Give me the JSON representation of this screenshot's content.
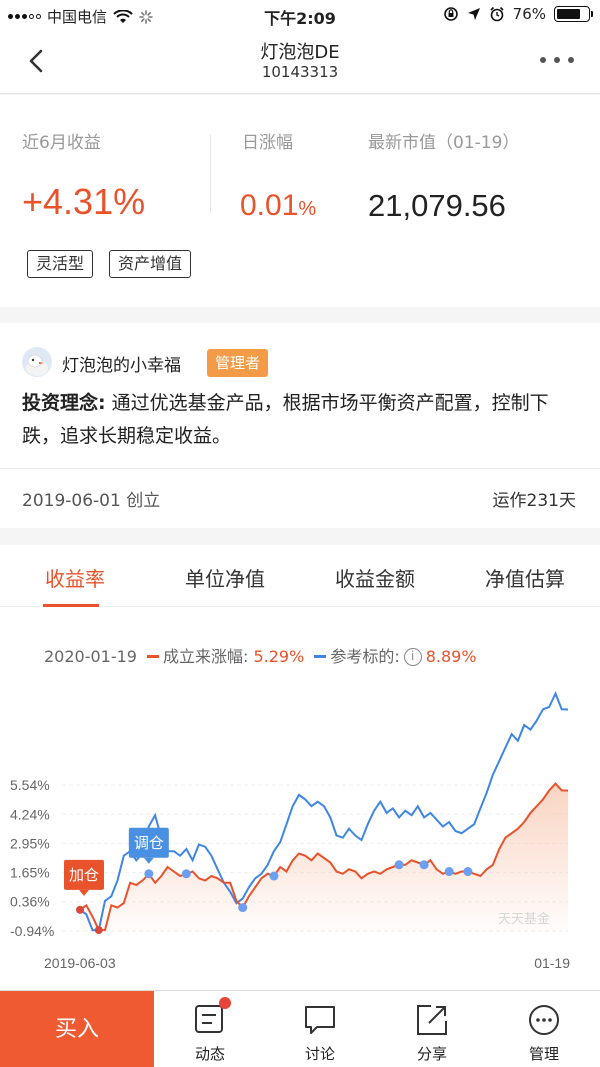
{
  "status_bar": {
    "carrier": "中国电信",
    "time": "下午2:09",
    "battery": "76%",
    "battery_level": 0.76
  },
  "nav": {
    "title": "灯泡泡DE",
    "code": "10143313"
  },
  "summary": {
    "six_month_label": "近6月收益",
    "six_month_value": "+4.31%",
    "daily_label": "日涨幅",
    "daily_value": "0.01",
    "daily_unit": "%",
    "market_label": "最新市值（01-19）",
    "market_value": "21,079.56",
    "tags": [
      "灵活型",
      "资产增值"
    ]
  },
  "manager": {
    "name": "灯泡泡的小幸福",
    "badge": "管理者",
    "philosophy_label": "投资理念:",
    "philosophy_text": " 通过优选基金产品，根据市场平衡资产配置，控制下跌，追求长期稳定收益。",
    "founded": "2019-06-01 创立",
    "running": "运作231天"
  },
  "chart_tabs": [
    "收益率",
    "单位净值",
    "收益金额",
    "净值估算"
  ],
  "legend": {
    "date": "2020-01-19",
    "series1_label": "成立来涨幅:",
    "series1_value": "5.29%",
    "series2_label": "参考标的:",
    "series2_value": "8.89%",
    "info_glyph": "i"
  },
  "chart_data": {
    "type": "line",
    "x_start_label": "2019-06-03",
    "x_end_label": "01-19",
    "y_ticks": [
      "5.54%",
      "4.24%",
      "2.95%",
      "1.65%",
      "0.36%",
      "-0.94%"
    ],
    "y_tick_values": [
      5.54,
      4.24,
      2.95,
      1.65,
      0.36,
      -0.94
    ],
    "watermark": "天天基金",
    "colors": {
      "fund": "#e8532b",
      "benchmark": "#3f86e4",
      "area": "#f8c9b3"
    },
    "series": [
      {
        "name": "成立来涨幅",
        "values": [
          0,
          0.2,
          -0.3,
          -0.9,
          -0.9,
          0.2,
          0.1,
          0.3,
          1.2,
          1.1,
          1.3,
          1.6,
          1.2,
          1.5,
          1.9,
          1.7,
          1.5,
          1.6,
          1.7,
          1.4,
          1.3,
          1.5,
          1.4,
          1.2,
          1.2,
          0.4,
          0.1,
          0.6,
          1.0,
          1.4,
          1.6,
          1.5,
          1.9,
          1.7,
          2.2,
          2.5,
          2.4,
          2.2,
          2.5,
          2.3,
          2.1,
          1.7,
          1.6,
          1.8,
          1.7,
          1.4,
          1.6,
          1.7,
          1.6,
          1.8,
          1.9,
          2.0,
          2.0,
          2.2,
          2.1,
          2.0,
          2.2,
          1.8,
          1.6,
          1.7,
          1.6,
          1.7,
          1.7,
          1.6,
          1.5,
          1.8,
          2.0,
          2.7,
          3.2,
          3.4,
          3.6,
          3.9,
          4.3,
          4.6,
          4.9,
          5.3,
          5.6,
          5.3,
          5.29
        ]
      },
      {
        "name": "参考标的",
        "values": [
          0,
          -0.2,
          -0.9,
          -0.9,
          0.4,
          0.6,
          1.3,
          2.4,
          2.6,
          2.2,
          2.5,
          3.7,
          4.2,
          3.2,
          2.6,
          2.6,
          2.4,
          2.7,
          2.2,
          2.9,
          2.8,
          2.4,
          1.8,
          1.2,
          0.8,
          0.3,
          0.5,
          1.0,
          1.4,
          1.6,
          2.0,
          2.6,
          3.0,
          3.8,
          4.6,
          5.1,
          4.9,
          4.6,
          4.8,
          4.6,
          4.1,
          3.3,
          3.2,
          3.6,
          3.3,
          3.1,
          3.8,
          4.4,
          4.8,
          4.3,
          4.5,
          4.1,
          4.4,
          4.2,
          4.6,
          4.1,
          4.3,
          4.0,
          3.7,
          3.9,
          3.5,
          3.4,
          3.6,
          3.8,
          4.5,
          5.2,
          6.0,
          6.6,
          7.2,
          7.8,
          7.5,
          8.2,
          8.0,
          8.4,
          8.9,
          9.0,
          9.6,
          8.9,
          8.89
        ]
      }
    ],
    "trade_markers": [
      {
        "label": "加仓",
        "index": 0,
        "color": "#e8532b"
      },
      {
        "label": "调仓",
        "index": 11,
        "color": "#4a90e2"
      }
    ],
    "red_dot_indices": [
      0,
      3
    ],
    "blue_dot_indices": [
      11,
      17,
      26,
      31,
      51,
      55,
      59,
      62
    ]
  },
  "bottom_bar": {
    "buy": "买入",
    "items": [
      {
        "label": "动态",
        "icon": "news-icon"
      },
      {
        "label": "讨论",
        "icon": "chat-icon"
      },
      {
        "label": "分享",
        "icon": "share-icon"
      },
      {
        "label": "管理",
        "icon": "more-icon"
      }
    ]
  }
}
